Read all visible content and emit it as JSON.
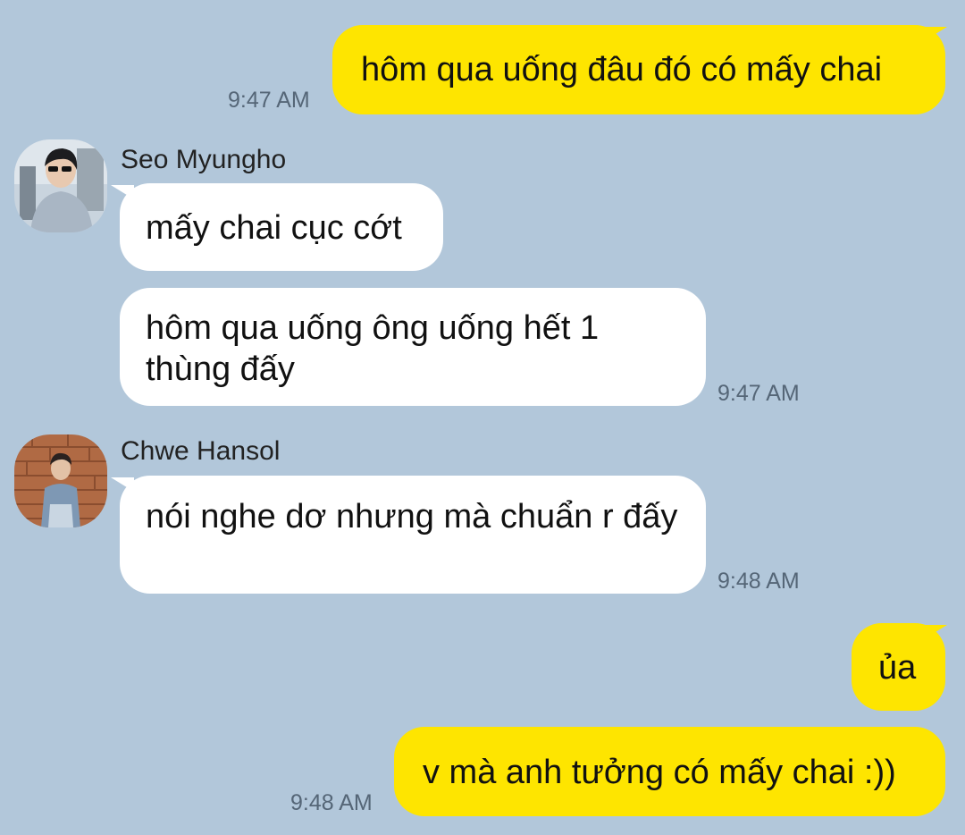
{
  "messages": [
    {
      "id": "m1",
      "type": "sent",
      "text": "hôm qua uống đâu đó có mấy chai",
      "time": "9:47 AM"
    },
    {
      "id": "m2",
      "type": "received",
      "sender": "Seo Myungho",
      "avatar": "avatar-seo-myungho",
      "text": "mấy chai cục cớt"
    },
    {
      "id": "m3",
      "type": "received",
      "text": "hôm qua uống ông uống hết 1 thùng đấy",
      "time": "9:47 AM"
    },
    {
      "id": "m4",
      "type": "received",
      "sender": "Chwe Hansol",
      "avatar": "avatar-chwe-hansol",
      "text": "nói nghe dơ nhưng mà chuẩn r đấy",
      "time": "9:48 AM"
    },
    {
      "id": "m5",
      "type": "sent",
      "text": "ủa"
    },
    {
      "id": "m6",
      "type": "sent",
      "text": "v mà anh tưởng có mấy chai :))",
      "time": "9:48 AM"
    }
  ],
  "colors": {
    "background": "#b2c7da",
    "sent_bubble": "#fee500",
    "received_bubble": "#ffffff",
    "timestamp": "#556677"
  }
}
